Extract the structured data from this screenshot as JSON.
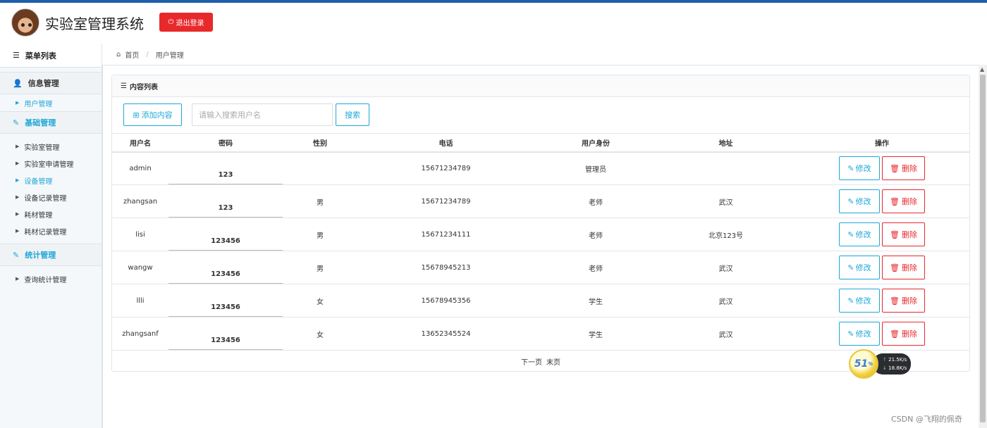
{
  "header": {
    "title": "实验室管理系统",
    "logout_label": "退出登录"
  },
  "sidebar": {
    "head": "菜单列表",
    "groups": [
      {
        "label": "信息管理",
        "items": [
          {
            "label": "用户管理",
            "active": true
          }
        ]
      },
      {
        "label": "基础管理",
        "items": [
          {
            "label": "实验室管理"
          },
          {
            "label": "实验室申请管理"
          },
          {
            "label": "设备管理",
            "active": true
          },
          {
            "label": "设备记录管理"
          },
          {
            "label": "耗材管理"
          },
          {
            "label": "耗材记录管理"
          }
        ]
      },
      {
        "label": "统计管理",
        "items": [
          {
            "label": "查询统计管理"
          }
        ]
      }
    ]
  },
  "breadcrumb": {
    "home": "首页",
    "current": "用户管理"
  },
  "panel": {
    "title": "内容列表",
    "add_label": "添加内容",
    "search_placeholder": "请输入搜索用户名",
    "search_label": "搜索"
  },
  "table": {
    "columns": [
      "用户名",
      "密码",
      "性别",
      "电话",
      "用户身份",
      "地址",
      "操作"
    ],
    "rows": [
      {
        "username": "admin",
        "password": "123",
        "gender": "",
        "phone": "15671234789",
        "role": "管理员",
        "address": ""
      },
      {
        "username": "zhangsan",
        "password": "123",
        "gender": "男",
        "phone": "15671234789",
        "role": "老师",
        "address": "武汉"
      },
      {
        "username": "lisi",
        "password": "123456",
        "gender": "男",
        "phone": "15671234111",
        "role": "老师",
        "address": "北京123号"
      },
      {
        "username": "wangw",
        "password": "123456",
        "gender": "男",
        "phone": "15678945213",
        "role": "老师",
        "address": "武汉"
      },
      {
        "username": "llli",
        "password": "123456",
        "gender": "女",
        "phone": "15678945356",
        "role": "学生",
        "address": "武汉"
      },
      {
        "username": "zhangsanf",
        "password": "123456",
        "gender": "女",
        "phone": "13652345524",
        "role": "学生",
        "address": "武汉"
      }
    ],
    "edit_label": "修改",
    "delete_label": "删除"
  },
  "pager": {
    "next": "下一页",
    "last": "末页"
  },
  "widget": {
    "percent": "51",
    "percent_sign": "%",
    "up": "21.5",
    "down": "18.8",
    "unit": "K/s"
  },
  "watermark": "CSDN @飞翔的佩奇",
  "colors": {
    "accent": "#1ea7d8",
    "danger": "#e8292c",
    "topline": "#1f5fa9"
  }
}
